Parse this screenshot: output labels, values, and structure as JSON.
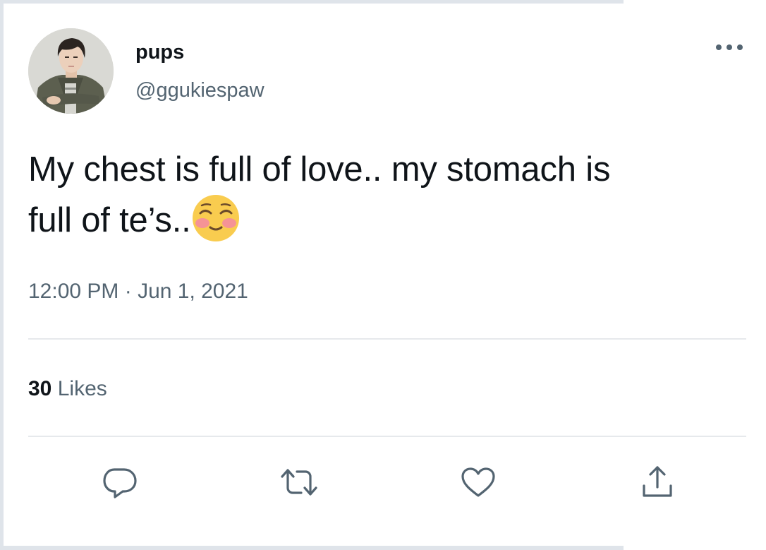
{
  "tweet": {
    "display_name": "pups",
    "handle": "@ggukiespaw",
    "text_line1": "My chest is full of love.. my stomach is",
    "text_line2": "full of te’s..",
    "emoji": "smiling-face-with-smiling-eyes",
    "timestamp": "12:00 PM · Jun 1, 2021",
    "likes_count": "30",
    "likes_label": "Likes"
  },
  "actions": {
    "reply": "reply-icon",
    "retweet": "retweet-icon",
    "like": "heart-icon",
    "share": "share-icon",
    "more": "more-options-icon"
  },
  "colors": {
    "primary_text": "#0f1419",
    "secondary_text": "#536471",
    "divider": "#e6e9ec",
    "frame": "#dfe4ea"
  }
}
